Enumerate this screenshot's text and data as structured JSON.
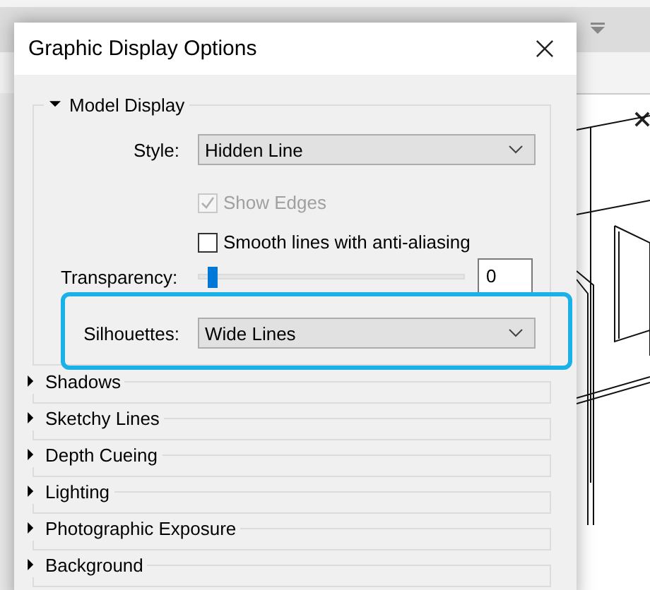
{
  "dialog": {
    "title": "Graphic Display Options"
  },
  "sections": [
    {
      "label": "Model Display",
      "expanded": true
    },
    {
      "label": "Shadows",
      "expanded": false
    },
    {
      "label": "Sketchy Lines",
      "expanded": false
    },
    {
      "label": "Depth Cueing",
      "expanded": false
    },
    {
      "label": "Lighting",
      "expanded": false
    },
    {
      "label": "Photographic Exposure",
      "expanded": false
    },
    {
      "label": "Background",
      "expanded": false
    }
  ],
  "model_display": {
    "style": {
      "label": "Style:",
      "value": "Hidden Line"
    },
    "show_edges": {
      "label": "Show Edges",
      "checked": true,
      "disabled": true
    },
    "smooth_lines": {
      "label": "Smooth lines with anti-aliasing",
      "checked": false,
      "disabled": false
    },
    "transparency": {
      "label": "Transparency:",
      "level": 0.03,
      "value": "0"
    },
    "silhouettes": {
      "label": "Silhouettes:",
      "value": "Wide Lines",
      "highlighted": true
    }
  }
}
